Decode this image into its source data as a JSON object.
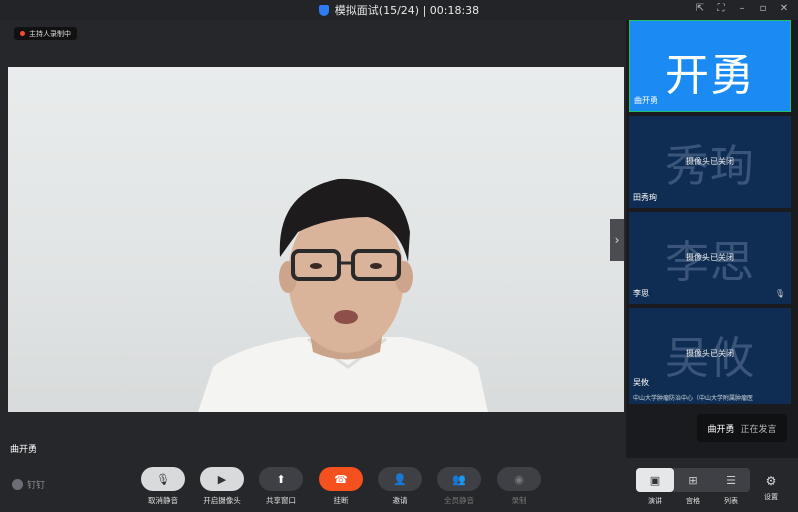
{
  "title_bar": {
    "meeting_title": "模拟面试(15/24) | 00:18:38",
    "controls": [
      "pin-icon",
      "fullscreen-icon",
      "minimize-icon",
      "maximize-icon",
      "close-icon"
    ]
  },
  "recording_badge": "主持人录制中",
  "main_video": {
    "speaker_name": "曲开勇"
  },
  "participants": [
    {
      "avatar_text": "开勇",
      "name": "曲开勇",
      "camera_status": "",
      "org": "",
      "active": true
    },
    {
      "avatar_text": "秀珣",
      "name": "田秀珣",
      "camera_status": "摄像头已关闭",
      "org": "",
      "active": false
    },
    {
      "avatar_text": "李思",
      "name": "李思",
      "camera_status": "摄像头已关闭",
      "org": "",
      "active": false
    },
    {
      "avatar_text": "吴攸",
      "name": "吴攸",
      "camera_status": "摄像头已关闭",
      "org": "中山大学肿瘤防治中心（中山大学附属肿瘤医",
      "active": false
    }
  ],
  "speaking_toast": {
    "name": "曲开勇",
    "status": "正在发言"
  },
  "brand": "钉钉",
  "toolbar": {
    "unmute": "取消静音",
    "camera_on": "开启摄像头",
    "share_window": "共享窗口",
    "hang_up": "挂断",
    "invite": "邀请",
    "mute_all": "全员静音",
    "record": "录制",
    "speaker_view": "演讲",
    "gallery_view": "宫格",
    "list_view": "列表",
    "settings": "设置"
  },
  "colors": {
    "accent_blue": "#1b8bf3",
    "hang_up_red": "#f4511e",
    "active_border": "#1fc16b",
    "tile_off_bg": "#0f2d52"
  }
}
